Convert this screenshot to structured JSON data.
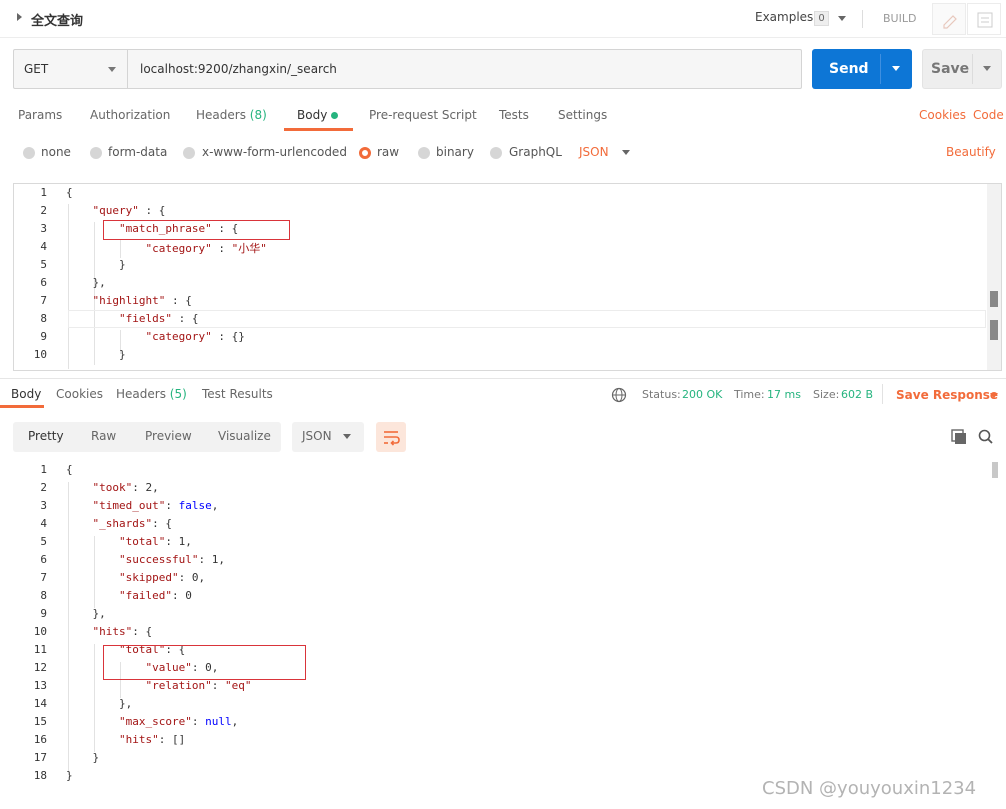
{
  "header": {
    "title": "全文查询",
    "examples_label": "Examples",
    "examples_count": "0",
    "build_label": "BUILD"
  },
  "request": {
    "method": "GET",
    "url": "localhost:9200/zhangxin/_search",
    "send_label": "Send",
    "save_label": "Save"
  },
  "request_tabs": {
    "params": "Params",
    "authorization": "Authorization",
    "headers_label": "Headers",
    "headers_count": "(8)",
    "body": "Body",
    "prerequest": "Pre-request Script",
    "tests": "Tests",
    "settings": "Settings",
    "cookies": "Cookies",
    "code": "Code"
  },
  "body_types": {
    "none": "none",
    "form_data": "form-data",
    "urlencoded": "x-www-form-urlencoded",
    "raw": "raw",
    "binary": "binary",
    "graphql": "GraphQL",
    "format": "JSON",
    "beautify": "Beautify"
  },
  "request_body": {
    "line_numbers": [
      "1",
      "2",
      "3",
      "4",
      "5",
      "6",
      "7",
      "8",
      "9",
      "10"
    ],
    "lines": [
      "{",
      "    \"query\" : {",
      "        \"match_phrase\" : {",
      "            \"category\" : \"小华\"",
      "        }",
      "    },",
      "    \"highlight\" : {",
      "        \"fields\" : {",
      "            \"category\" : {}",
      "        }"
    ]
  },
  "response_tabs": {
    "body": "Body",
    "cookies": "Cookies",
    "headers_label": "Headers",
    "headers_count": "(5)",
    "test_results": "Test Results"
  },
  "response_status": {
    "status_label": "Status:",
    "status_value": "200 OK",
    "time_label": "Time:",
    "time_value": "17 ms",
    "size_label": "Size:",
    "size_value": "602 B",
    "save_response": "Save Response"
  },
  "response_view": {
    "pretty": "Pretty",
    "raw": "Raw",
    "preview": "Preview",
    "visualize": "Visualize",
    "format": "JSON"
  },
  "response_body": {
    "line_numbers": [
      "1",
      "2",
      "3",
      "4",
      "5",
      "6",
      "7",
      "8",
      "9",
      "10",
      "11",
      "12",
      "13",
      "14",
      "15",
      "16",
      "17",
      "18"
    ],
    "lines": [
      "{",
      "    \"took\": 2,",
      "    \"timed_out\": false,",
      "    \"_shards\": {",
      "        \"total\": 1,",
      "        \"successful\": 1,",
      "        \"skipped\": 0,",
      "        \"failed\": 0",
      "    },",
      "    \"hits\": {",
      "        \"total\": {",
      "            \"value\": 0,",
      "            \"relation\": \"eq\"",
      "        },",
      "        \"max_score\": null,",
      "        \"hits\": []",
      "    }",
      "}"
    ]
  },
  "watermark": "CSDN @youyouxin1234",
  "colors": {
    "accent": "#f26b3a",
    "send": "#0d76d6",
    "success": "#26b47f",
    "highlight_box": "#d9343a"
  }
}
